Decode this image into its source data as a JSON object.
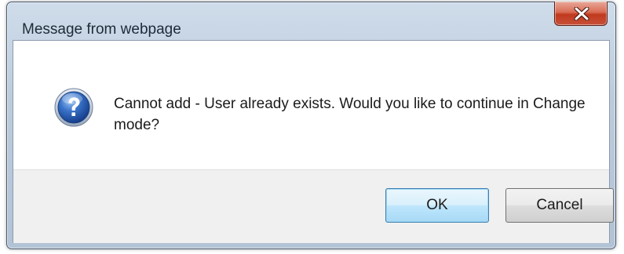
{
  "window": {
    "title": "Message from webpage",
    "close_icon": "close-icon"
  },
  "dialog": {
    "icon": "question-icon",
    "message": "Cannot add - User already exists.  Would you like to continue in Change mode?"
  },
  "buttons": {
    "ok_label": "OK",
    "cancel_label": "Cancel"
  },
  "colors": {
    "title_bar": "#bccbdc",
    "close_button": "#c7503a",
    "footer_background": "#f0f0f0",
    "default_button_border": "#3c7fb1"
  }
}
